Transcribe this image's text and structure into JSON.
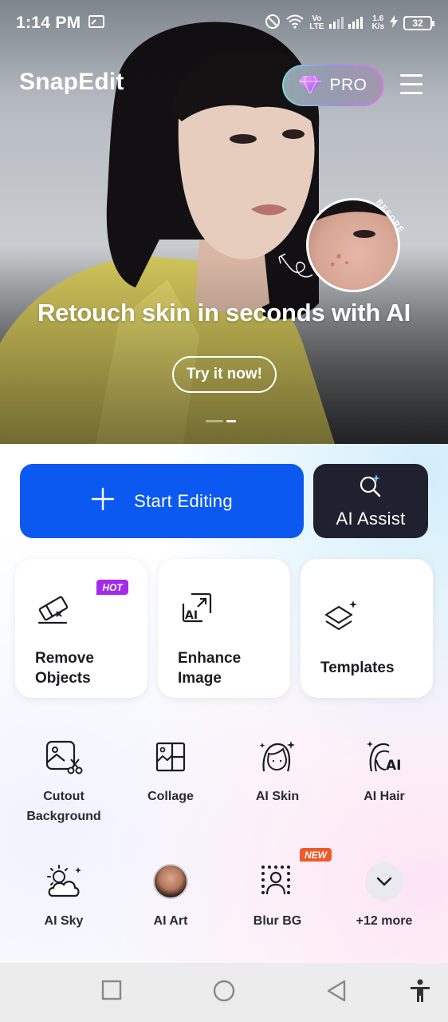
{
  "status_bar": {
    "time": "1:14 PM",
    "network_top": "Vo",
    "network_bottom": "LTE",
    "speed_top": "1.6",
    "speed_bottom": "K/s",
    "battery": "32"
  },
  "header": {
    "app_title": "SnapEdit",
    "pro_label": "PRO"
  },
  "hero": {
    "before_label": "BEFORE",
    "headline": "Retouch skin in seconds with AI",
    "cta_label": "Try it now!",
    "carousel_pages": 2,
    "carousel_active": 2
  },
  "actions": {
    "start_label": "Start Editing",
    "assist_label": "AI Assist"
  },
  "cards": [
    {
      "line1": "Remove",
      "line2": "Objects",
      "badge": "HOT"
    },
    {
      "line1": "Enhance",
      "line2": "Image"
    },
    {
      "label": "Templates"
    }
  ],
  "tools": {
    "cutout_line1": "Cutout",
    "cutout_line2": "Background",
    "collage": "Collage",
    "ai_skin": "AI Skin",
    "ai_hair": "AI Hair",
    "ai_sky": "AI Sky",
    "ai_art": "AI Art",
    "blur_bg": "Blur BG",
    "blur_badge": "NEW",
    "more": "+12 more"
  },
  "colors": {
    "primary_blue": "#0b59f0",
    "assist_dark": "#20212f",
    "hot_badge": "#a22bea",
    "new_badge": "#f05a28"
  }
}
